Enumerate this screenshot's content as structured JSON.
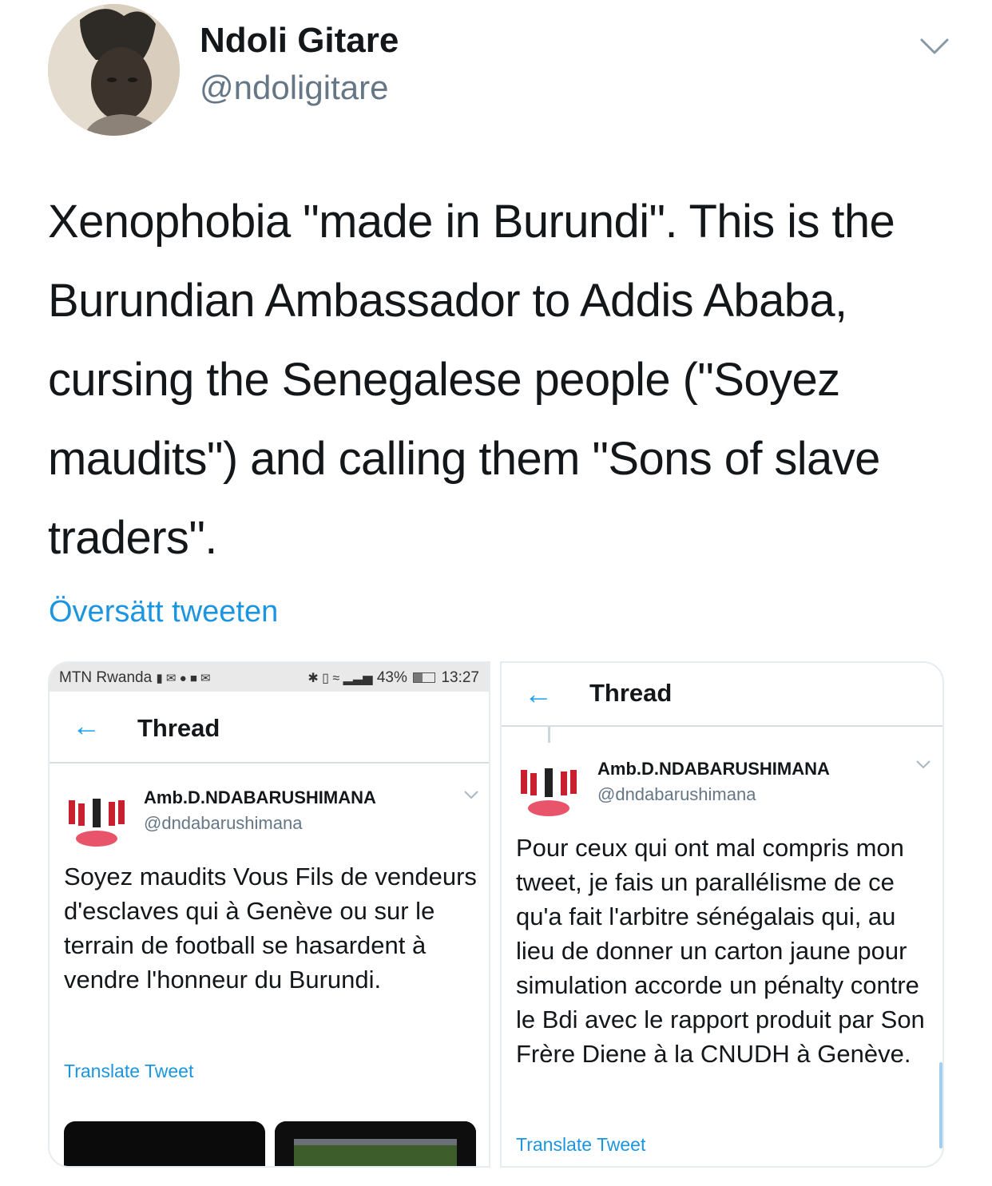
{
  "author": {
    "display_name": "Ndoli Gitare",
    "handle": "@ndoligitare"
  },
  "tweet": {
    "text": "Xenophobia \"made in Burundi\". This is the Burundian Ambassador to Addis Ababa, cursing the Senegalese people (\"Soyez maudits\") and calling them \"Sons of slave traders\".",
    "translate_label": "Översätt tweeten"
  },
  "media": {
    "left": {
      "status_bar": {
        "carrier": "MTN Rwanda",
        "battery": "43%",
        "time": "13:27"
      },
      "header_title": "Thread",
      "name": "Amb.D.NDABARUSHIMANA",
      "handle": "@dndabarushimana",
      "text": "Soyez maudits Vous Fils de vendeurs d'esclaves qui à Genève ou sur le terrain de football se hasardent à vendre l'honneur du Burundi.",
      "translate_label": "Translate Tweet"
    },
    "right": {
      "header_title": "Thread",
      "name": "Amb.D.NDABARUSHIMANA",
      "handle": "@dndabarushimana",
      "text": "Pour ceux qui ont mal compris mon tweet, je fais un parallélisme de ce qu'a fait l'arbitre sénégalais qui, au lieu de donner un carton jaune pour simulation accorde un pénalty contre le Bdi avec le rapport produit par Son Frère Diene à la CNUDH à Genève.",
      "translate_label": "Translate Tweet"
    }
  },
  "icons": {
    "caret": "chevron-down-icon",
    "back": "arrow-left-icon"
  },
  "colors": {
    "link": "#1b95e0",
    "accent": "#1da1f2",
    "secondary_text": "#657786"
  }
}
